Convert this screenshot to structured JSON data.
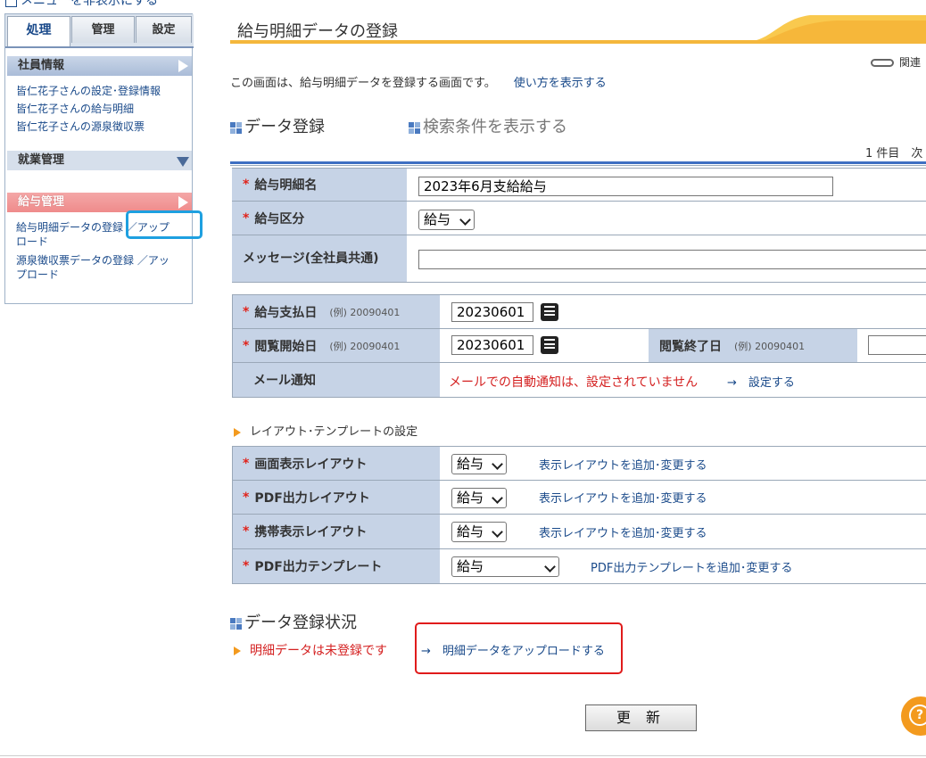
{
  "sidebar": {
    "top_link": "メニューを非表示にする",
    "tabs": [
      "処理",
      "管理",
      "設定"
    ],
    "sections": [
      {
        "title": "社員情報",
        "links": [
          "皆仁花子さんの設定･登録情報",
          "皆仁花子さんの給与明細",
          "皆仁花子さんの源泉徴収票"
        ]
      },
      {
        "title": "就業管理",
        "links": []
      },
      {
        "title": "給与管理",
        "links": [
          "給与明細データの登録 ／アップロード",
          "源泉徴収票データの登録 ／アップロード"
        ]
      }
    ]
  },
  "header": {
    "title": "給与明細データの登録",
    "related": "関連",
    "description": "この画面は、給与明細データを登録する画面です。",
    "howto_link": "使い方を表示する"
  },
  "data_entry": {
    "heading": "データ登録",
    "search_toggle": "検索条件を表示する",
    "paging": "1 件目　次"
  },
  "form": {
    "name_label": "給与明細名",
    "name_value": "2023年6月支給給与",
    "kubun_label": "給与区分",
    "kubun_value": "給与",
    "message_label": "メッセージ(全社員共通)",
    "message_value": "",
    "pay_date_label": "給与支払日",
    "example": "(例) 20090401",
    "pay_date_value": "20230601",
    "view_start_label": "閲覧開始日",
    "view_start_value": "20230601",
    "view_end_label": "閲覧終了日",
    "view_end_value": "",
    "mail_label": "メール通知",
    "mail_status": "メールでの自動通知は、設定されていません",
    "mail_set_link": "→　設定する"
  },
  "layout_section": {
    "title": "レイアウト･テンプレートの設定",
    "rows": [
      {
        "label": "画面表示レイアウト",
        "value": "給与",
        "link": "表示レイアウトを追加･変更する"
      },
      {
        "label": "PDF出力レイアウト",
        "value": "給与",
        "link": "表示レイアウトを追加･変更する"
      },
      {
        "label": "携帯表示レイアウト",
        "value": "給与",
        "link": "表示レイアウトを追加･変更する"
      },
      {
        "label": "PDF出力テンプレート",
        "value": "給与",
        "link": "PDF出力テンプレートを追加･変更する"
      }
    ]
  },
  "status": {
    "heading": "データ登録状況",
    "text": "明細データは未登録です",
    "upload_link": "→　明細データをアップロードする"
  },
  "buttons": {
    "update": "更 新",
    "help": "?"
  },
  "colors": {
    "accent_orange": "#f4b73c",
    "label_bg": "#c6d3e6",
    "required_red": "#e0231b",
    "highlight_blue": "#1ea0e0",
    "highlight_red": "#e01b1b"
  }
}
